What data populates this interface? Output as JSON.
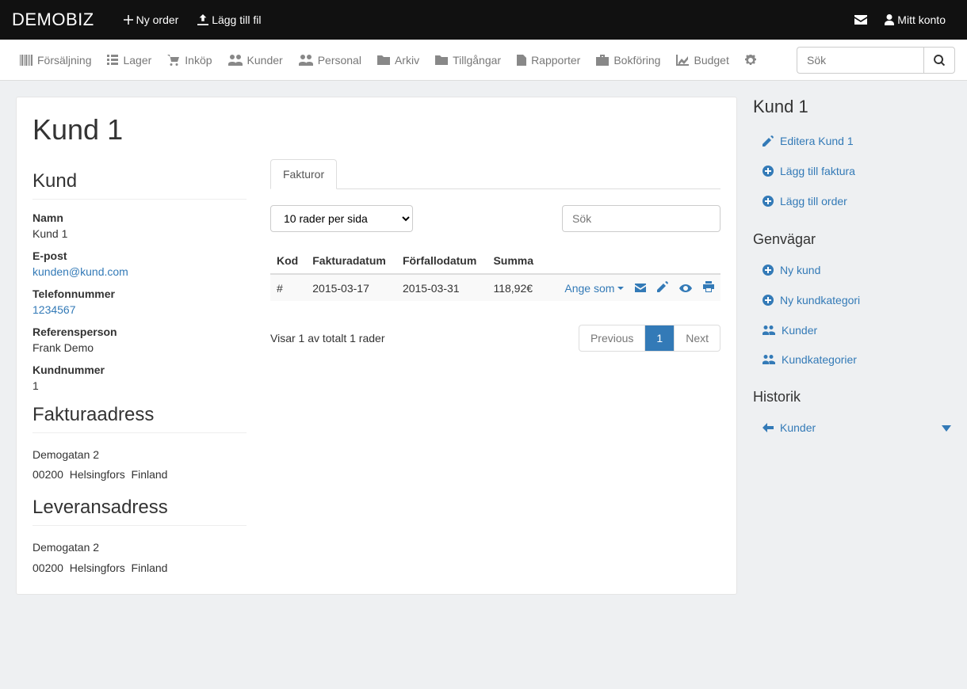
{
  "brand": "DEMOBIZ",
  "topbar": {
    "new_order": "Ny order",
    "add_file": "Lägg till fil",
    "my_account": "Mitt konto"
  },
  "nav": {
    "items": [
      "Försäljning",
      "Lager",
      "Inköp",
      "Kunder",
      "Personal",
      "Arkiv",
      "Tillgångar",
      "Rapporter",
      "Bokföring",
      "Budget"
    ],
    "search_placeholder": "Sök"
  },
  "page": {
    "title": "Kund 1",
    "sections": {
      "customer": "Kund",
      "invoice_address": "Fakturaadress",
      "delivery_address": "Leveransadress"
    },
    "labels": {
      "name": "Namn",
      "email": "E-post",
      "phone": "Telefonnummer",
      "reference": "Referensperson",
      "customer_no": "Kundnummer"
    },
    "values": {
      "name": "Kund 1",
      "email": "kunden@kund.com",
      "phone": "1234567",
      "reference": "Frank Demo",
      "customer_no": "1"
    },
    "address": {
      "street": "Demogatan 2",
      "postal": "00200",
      "city": "Helsingfors",
      "country": "Finland"
    }
  },
  "invoices": {
    "tab_label": "Fakturor",
    "rows_per_page_selected": "10 rader per sida",
    "search_placeholder": "Sök",
    "columns": [
      "Kod",
      "Fakturadatum",
      "Förfallodatum",
      "Summa"
    ],
    "rows": [
      {
        "kod": "#",
        "fakturadatum": "2015-03-17",
        "forfallodatum": "2015-03-31",
        "summa": "118,92€",
        "action_label": "Ange som"
      }
    ],
    "showing": "Visar 1 av totalt 1 rader",
    "pagination": {
      "prev": "Previous",
      "pages": [
        "1"
      ],
      "next": "Next"
    }
  },
  "sidebar": {
    "title": "Kund 1",
    "primary": [
      {
        "label": "Editera Kund 1",
        "icon": "edit"
      },
      {
        "label": "Lägg till faktura",
        "icon": "plus-circle"
      },
      {
        "label": "Lägg till order",
        "icon": "plus-circle"
      }
    ],
    "shortcuts_title": "Genvägar",
    "shortcuts": [
      {
        "label": "Ny kund",
        "icon": "plus-circle"
      },
      {
        "label": "Ny kundkategori",
        "icon": "plus-circle"
      },
      {
        "label": "Kunder",
        "icon": "users"
      },
      {
        "label": "Kundkategorier",
        "icon": "users"
      }
    ],
    "history_title": "Historik",
    "history": [
      {
        "label": "Kunder",
        "icon": "arrow-left"
      }
    ]
  }
}
